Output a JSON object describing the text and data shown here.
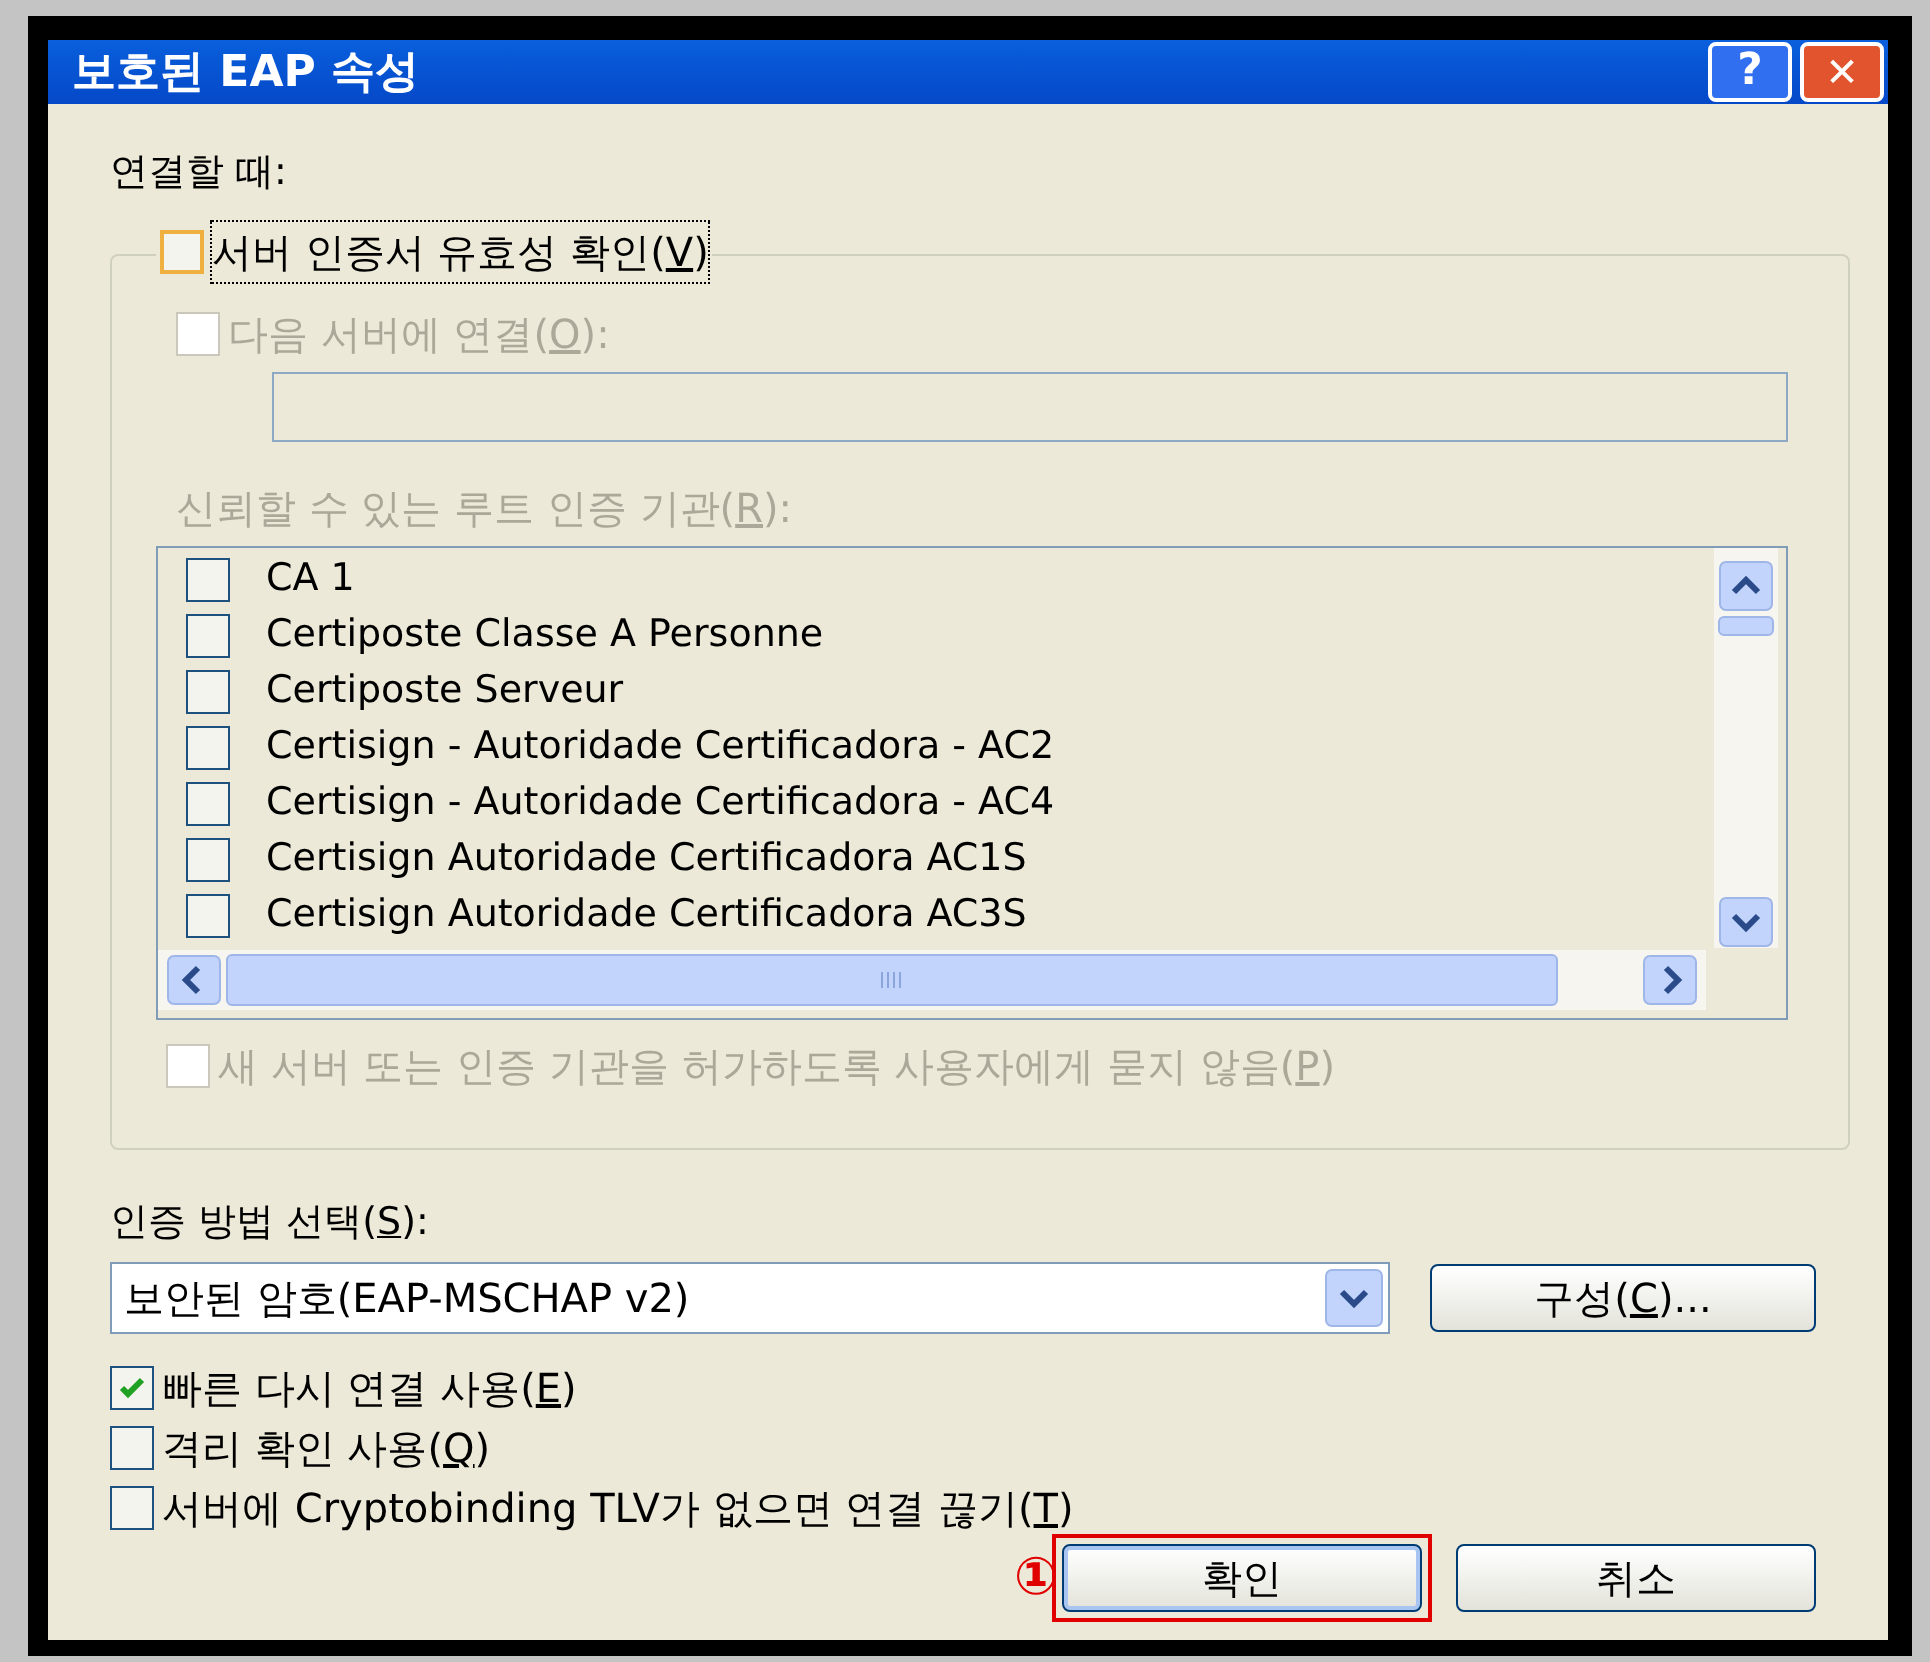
{
  "window": {
    "title": "보호된 EAP 속성",
    "help_button": "?",
    "close_button": "✕"
  },
  "connect_label": "연결할 때:",
  "validate_cert": {
    "label": [
      "서버 인증서 유효성 확인(",
      "V",
      ")"
    ],
    "checked": false,
    "focused": true
  },
  "connect_servers": {
    "label": [
      "다음 서버에 연결(",
      "O",
      "):"
    ],
    "checked": false,
    "disabled": true
  },
  "root_ca_label": {
    "label": [
      "신뢰할 수 있는 루트 인증 기관(",
      "R",
      "):"
    ],
    "disabled": true
  },
  "root_cas": [
    {
      "name": "CA 1",
      "checked": false
    },
    {
      "name": "Certiposte Classe A Personne",
      "checked": false
    },
    {
      "name": "Certiposte Serveur",
      "checked": false
    },
    {
      "name": "Certisign - Autoridade Certificadora - AC2",
      "checked": false
    },
    {
      "name": "Certisign - Autoridade Certificadora - AC4",
      "checked": false
    },
    {
      "name": "Certisign Autoridade Certificadora AC1S",
      "checked": false
    },
    {
      "name": "Certisign Autoridade Certificadora AC3S",
      "checked": false
    }
  ],
  "no_prompt": {
    "label": [
      "새 서버 또는 인증 기관을 허가하도록 사용자에게 묻지 않음(",
      "P",
      ")"
    ],
    "checked": false,
    "disabled": true
  },
  "auth_method_label": [
    "인증 방법 선택(",
    "S",
    "):"
  ],
  "auth_method": {
    "value": "보안된 암호(EAP-MSCHAP v2)"
  },
  "configure_button": [
    "구성(",
    "C",
    ")..."
  ],
  "options": [
    {
      "label": [
        "빠른 다시 연결 사용(",
        "E",
        ")"
      ],
      "checked": true
    },
    {
      "label": [
        "격리 확인 사용(",
        "Q",
        ")"
      ],
      "checked": false
    },
    {
      "label": [
        "서버에 Cryptobinding TLV가 없으면 연결 끊기(",
        "T",
        ")"
      ],
      "checked": false
    }
  ],
  "buttons": [
    {
      "label": "확인",
      "highlighted": true
    },
    {
      "label": "취소",
      "highlighted": false
    }
  ],
  "annotation": {
    "label": "①"
  }
}
